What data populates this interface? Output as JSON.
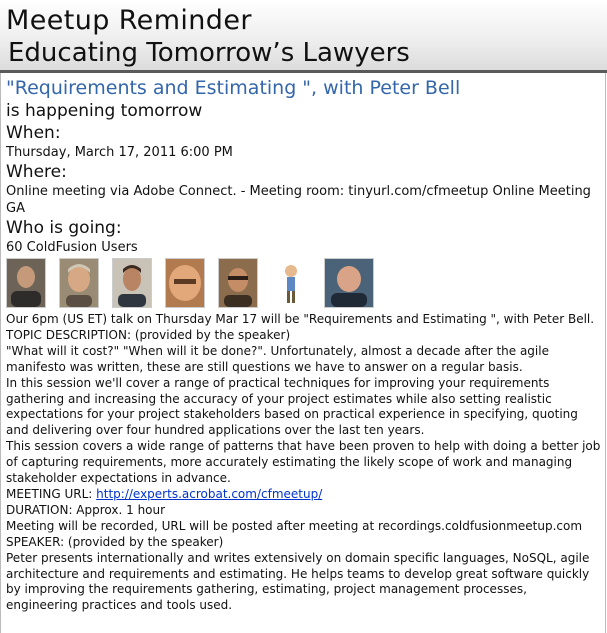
{
  "header": {
    "title": "Meetup Reminder",
    "subtitle": "Educating Tomorrow’s Lawyers"
  },
  "event": {
    "title": "\"Requirements and Estimating \", with Peter Bell",
    "happening": "is happening tomorrow",
    "when_label": "When:",
    "when_value": "Thursday, March 17, 2011 6:00 PM",
    "where_label": "Where:",
    "where_value": "Online meeting via Adobe Connect. - Meeting room: tinyurl.com/cfmeetup Online Meeting GA",
    "who_label": "Who is going:",
    "who_value": "60 ColdFusion Users"
  },
  "avatars": [
    {
      "name": "member-1"
    },
    {
      "name": "member-2"
    },
    {
      "name": "member-3"
    },
    {
      "name": "member-4"
    },
    {
      "name": "member-5"
    },
    {
      "name": "member-6"
    },
    {
      "name": "member-7"
    }
  ],
  "description": {
    "line1": "Our 6pm (US ET) talk on Thursday Mar 17 will be \"Requirements and Estimating \", with Peter Bell.",
    "line2": "TOPIC DESCRIPTION: (provided by the speaker)",
    "line3": "\"What will it cost?\" \"When will it be done?\". Unfortunately, almost a decade after the agile manifesto was written, these are still questions we have to answer on a regular basis.",
    "line4": "In this session we'll cover a range of practical techniques for improving your requirements gathering and increasing the accuracy of your project estimates while also setting realistic expectations for your project stakeholders based on practical experience in specifying, quoting and delivering over four hundred applications over the last ten years.",
    "line5": "This session covers a wide range of patterns that have been proven to help with doing a better job of capturing requirements, more accurately estimating the likely scope of work and managing stakeholder expectations in advance.",
    "meeting_url_label": "MEETING URL: ",
    "meeting_url": "http://experts.acrobat.com/cfmeetup/",
    "duration": "DURATION: Approx. 1 hour",
    "recorded": "Meeting will be recorded, URL will be posted after meeting at recordings.coldfusionmeetup.com",
    "speaker_label": "SPEAKER: (provided by the speaker)",
    "speaker_bio": "Peter presents internationally and writes extensively on domain specific languages, NoSQL, agile architecture and requirements and estimating. He helps teams to develop great software quickly by improving the requirements gathering, estimating, project management processes, engineering practices and tools used."
  }
}
